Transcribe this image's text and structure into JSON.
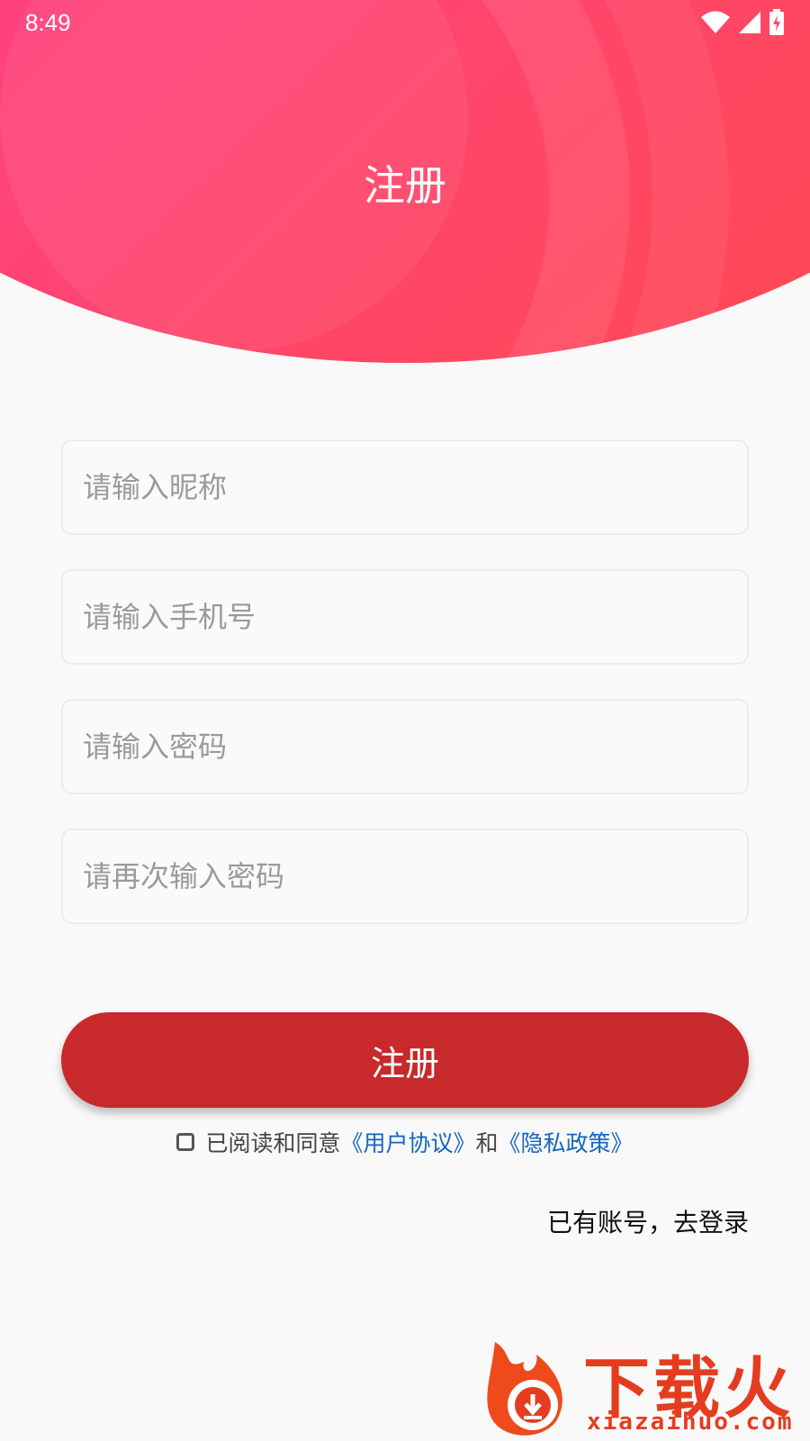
{
  "status_bar": {
    "time": "8:49",
    "icons": [
      "wifi-icon",
      "signal-icon",
      "battery-charging-icon"
    ]
  },
  "header": {
    "title": "注册",
    "gradient_colors": [
      "#ff3399",
      "#ff4a4a"
    ]
  },
  "form": {
    "nickname_placeholder": "请输入昵称",
    "phone_placeholder": "请输入手机号",
    "password_placeholder": "请输入密码",
    "confirm_password_placeholder": "请再次输入密码"
  },
  "register_button": {
    "label": "注册",
    "color": "#c8292b"
  },
  "agreement": {
    "checked": false,
    "prefix": "已阅读和同意",
    "user_agreement": "《用户协议》",
    "conjunction": "和",
    "privacy_policy": "《隐私政策》",
    "link_color": "#1565c0"
  },
  "login_link": "已有账号，去登录",
  "watermark": {
    "brand": "下载火",
    "url": "xiazaihuo.com"
  }
}
